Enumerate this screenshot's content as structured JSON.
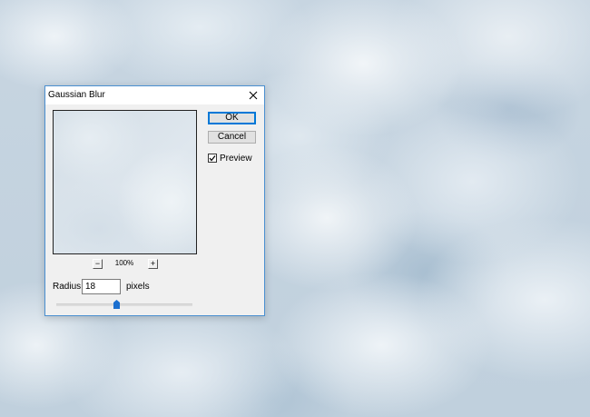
{
  "dialog": {
    "title": "Gaussian Blur",
    "ok_label": "OK",
    "cancel_label": "Cancel",
    "preview_label": "Preview",
    "preview_checked": true,
    "zoom_minus": "−",
    "zoom_plus": "+",
    "zoom_level": "100%",
    "radius_label": "Radius:",
    "radius_value": "18",
    "radius_unit": "pixels",
    "accent_color": "#0078d7"
  }
}
